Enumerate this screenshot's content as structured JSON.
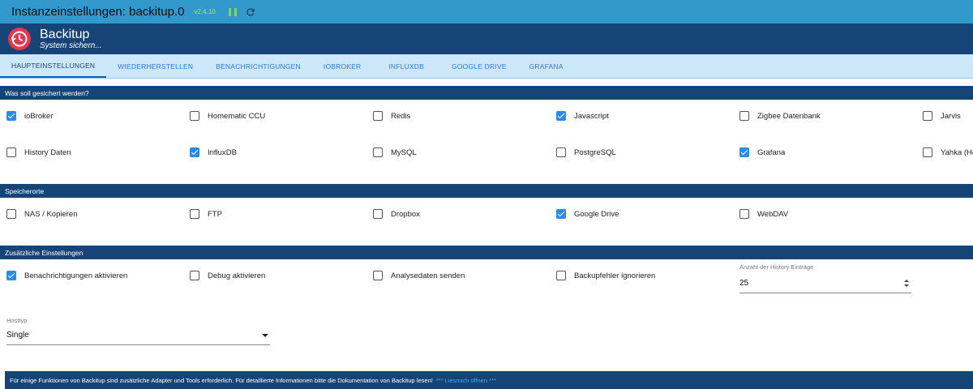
{
  "titlebar": {
    "title": "Instanzeinstellungen: backitup.0",
    "version": "v2.4.10"
  },
  "header": {
    "name": "Backitup",
    "subtitle": "System sichern..."
  },
  "tabs": [
    {
      "label": "HAUPTEINSTELLUNGEN",
      "active": true
    },
    {
      "label": "WIEDERHERSTELLEN"
    },
    {
      "label": "BENACHRICHTIGUNGEN"
    },
    {
      "label": "IOBROKER"
    },
    {
      "label": "INFLUXDB"
    },
    {
      "label": "GOOGLE DRIVE"
    },
    {
      "label": "GRAFANA"
    }
  ],
  "sections": {
    "what": "Was soll gesichert werden?",
    "storage": "Speicherorte",
    "extra": "Zusätzliche Einstellungen"
  },
  "backup_items": [
    {
      "label": "ioBroker",
      "checked": true
    },
    {
      "label": "Homematic CCU",
      "checked": false
    },
    {
      "label": "Redis",
      "checked": false
    },
    {
      "label": "Javascript",
      "checked": true
    },
    {
      "label": "Zigbee Datenbank",
      "checked": false
    },
    {
      "label": "Jarvis",
      "checked": false
    },
    {
      "label": "History Daten",
      "checked": false
    },
    {
      "label": "InfluxDB",
      "checked": true
    },
    {
      "label": "MySQL",
      "checked": false
    },
    {
      "label": "PostgreSQL",
      "checked": false
    },
    {
      "label": "Grafana",
      "checked": true
    },
    {
      "label": "Yahka (Ho",
      "checked": false
    }
  ],
  "storage_items": [
    {
      "label": "NAS / Kopieren",
      "checked": false
    },
    {
      "label": "FTP",
      "checked": false
    },
    {
      "label": "Dropbox",
      "checked": false
    },
    {
      "label": "Google Drive",
      "checked": true
    },
    {
      "label": "WebDAV",
      "checked": false
    }
  ],
  "extra_items": [
    {
      "label": "Benachrichtigungen aktivieren",
      "checked": true
    },
    {
      "label": "Debug aktivieren",
      "checked": false
    },
    {
      "label": "Analysedaten senden",
      "checked": false
    },
    {
      "label": "Backupfehler ignorieren",
      "checked": false
    }
  ],
  "history": {
    "label": "Anzahl der History Einträge",
    "value": "25"
  },
  "hosttype": {
    "label": "Hosttyp",
    "value": "Single"
  },
  "footer": {
    "text": "Für einige Funktionen von Backitup sind zusätzliche Adapter und Tools erforderlich. Für detaillierte Informationen bitte die Dokumentation von Backitup lesen!",
    "link": "*** Liesmich öffnen ***"
  },
  "colors": {
    "header": "#164477",
    "titlebar": "#3399cc",
    "tabs_bg": "#cce7fa",
    "accent": "#2a8ce6"
  }
}
